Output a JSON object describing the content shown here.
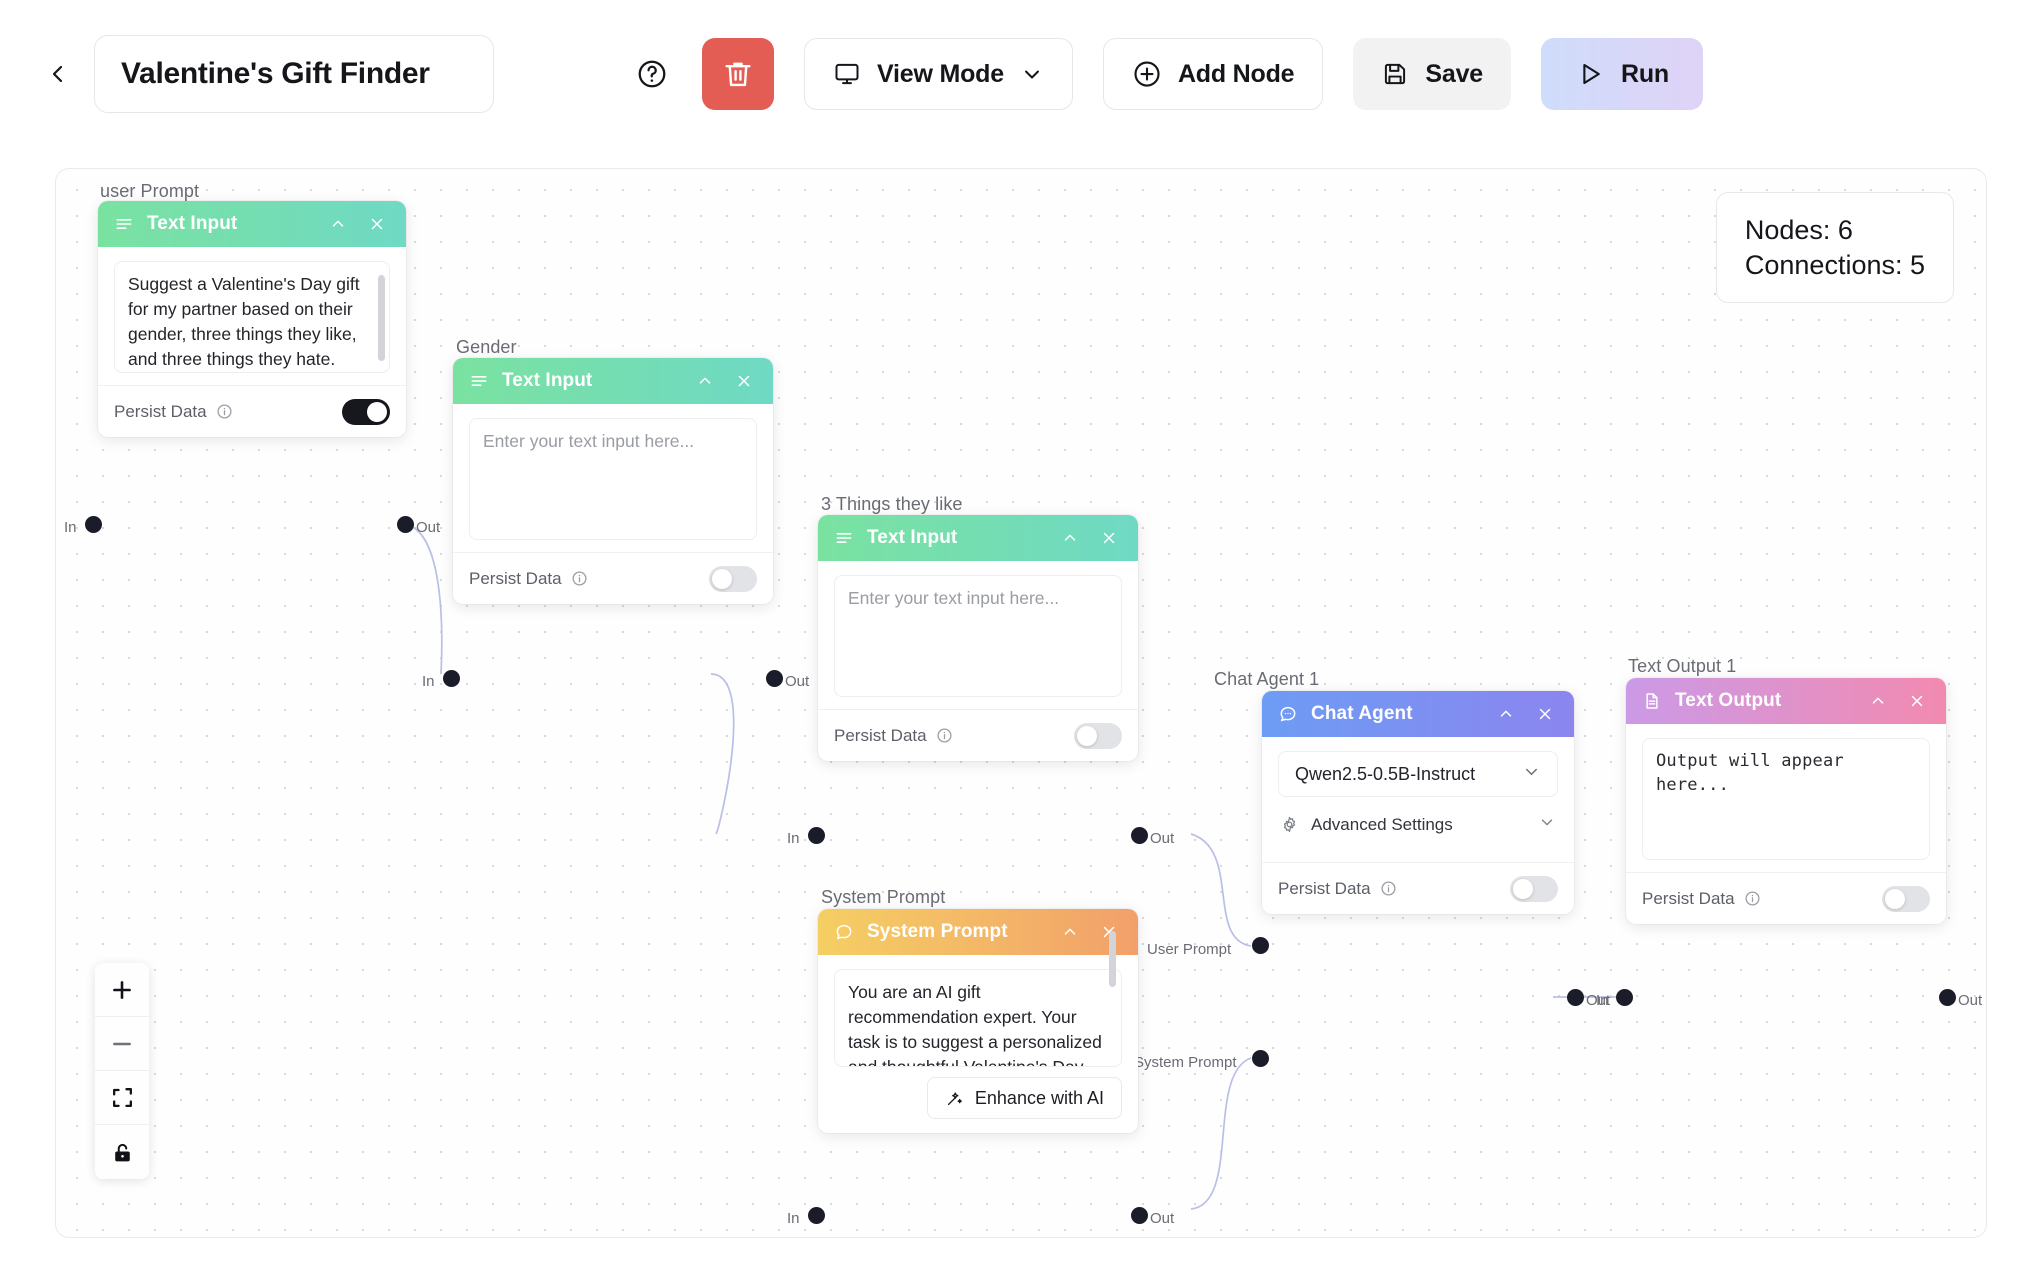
{
  "header": {
    "back_icon": "chevron-left-icon",
    "workflow_title": "Valentine's Gift Finder",
    "help_icon": "help-circle-icon",
    "delete_icon": "trash-icon",
    "view_mode_label": "View Mode",
    "view_mode_icon": "monitor-icon",
    "view_mode_chevron": "chevron-down-icon",
    "add_node_label": "Add Node",
    "add_node_icon": "plus-circle-icon",
    "save_label": "Save",
    "save_icon": "save-disk-icon",
    "run_label": "Run",
    "run_icon": "play-triangle-icon"
  },
  "canvas": {
    "stats": {
      "nodes_text": "Nodes: 6",
      "connections_text": "Connections: 5"
    },
    "zoom_controls": [
      {
        "name": "zoom-in",
        "icon": "plus-icon"
      },
      {
        "name": "zoom-out",
        "icon": "minus-icon"
      },
      {
        "name": "fit-view",
        "icon": "fit-screen-icon"
      },
      {
        "name": "lock-canvas",
        "icon": "lock-open-icon"
      }
    ],
    "persist_label": "Persist Data",
    "persist_info_icon": "info-circle-icon",
    "collapse_icon": "chevron-up-icon",
    "close_icon": "close-x-icon",
    "port_in_label": "In",
    "port_out_label": "Out"
  },
  "nodes": [
    {
      "id": "user-prompt",
      "caption": "user Prompt",
      "header_title": "Text Input",
      "header_icon": "text-lines-icon",
      "value": "Suggest a Valentine's Day gift for my partner based on their gender, three things they like, and three things they hate. Provide a thoughtful and unique gift idea that aligns with their interests while avoiding things they dislike.",
      "persist_on": true
    },
    {
      "id": "gender",
      "caption": "Gender",
      "header_title": "Text Input",
      "header_icon": "text-lines-icon",
      "placeholder": "Enter your text input here...",
      "persist_on": false
    },
    {
      "id": "three-things-like",
      "caption": "3 Things they like",
      "header_title": "Text Input",
      "header_icon": "text-lines-icon",
      "placeholder": "Enter your text input here...",
      "persist_on": false
    },
    {
      "id": "chat-agent",
      "caption": "Chat Agent 1",
      "header_title": "Chat Agent",
      "header_icon": "chat-bubble-icon",
      "model": "Qwen2.5-0.5B-Instruct",
      "model_chevron_icon": "chevron-down-icon",
      "advanced_label": "Advanced Settings",
      "advanced_icon": "gear-icon",
      "advanced_chevron_icon": "chevron-down-icon",
      "port_user_prompt": "User Prompt",
      "port_system_prompt": "System Prompt",
      "persist_on": false
    },
    {
      "id": "text-output",
      "caption": "Text Output 1",
      "header_title": "Text Output",
      "header_icon": "document-icon",
      "value": "Output will appear here...",
      "persist_on": false
    },
    {
      "id": "system-prompt",
      "caption": "System Prompt",
      "header_title": "System Prompt",
      "header_icon": "chat-bubble-icon",
      "value": "You are an AI gift recommendation expert. Your task is to suggest a personalized and thoughtful Valentine's Day gift based on the recipient's likes, dislikes, and gender.",
      "enhance_label": "Enhance with AI",
      "enhance_icon": "magic-wand-icon",
      "persist_on": false
    }
  ],
  "colors": {
    "delete_red": "#e35d54",
    "green_header_start": "#7ae2a0",
    "green_header_end": "#6fd9c4",
    "blue_header_start": "#6d9cf4",
    "blue_header_end": "#8c85ef",
    "pink_header_start": "#cb9ae6",
    "pink_header_end": "#f28ab0",
    "orange_header_start": "#f5cf63",
    "orange_header_end": "#f2a06a",
    "run_gradient_start": "#cfdcfb",
    "run_gradient_end": "#dfd3f7"
  }
}
